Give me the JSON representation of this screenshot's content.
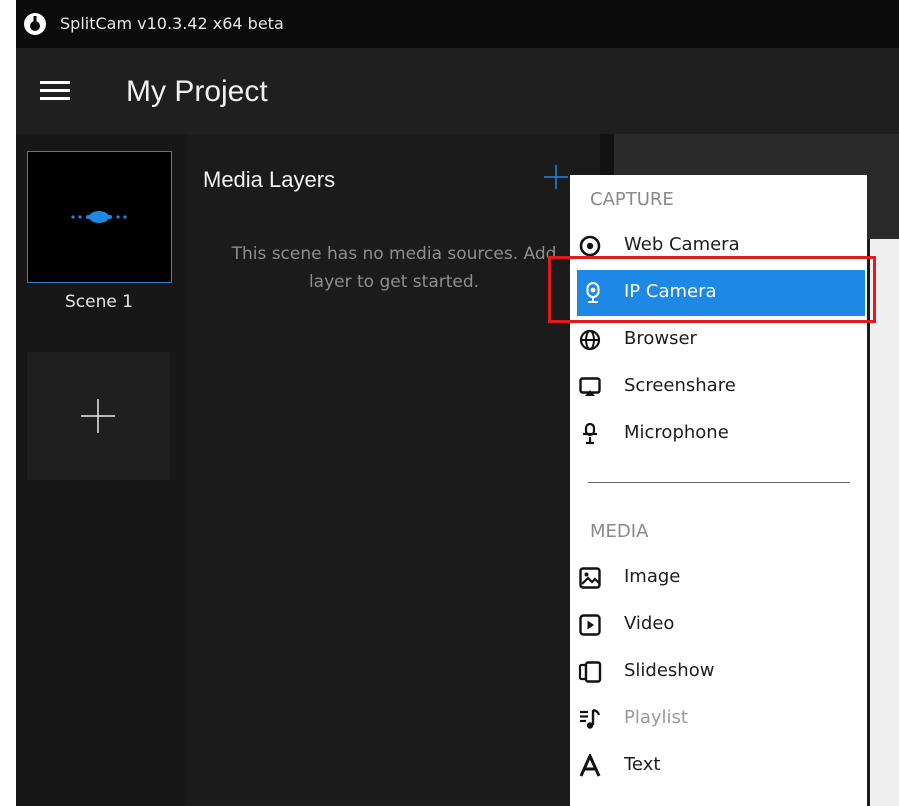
{
  "app": {
    "title": "SplitCam v10.3.42 x64 beta"
  },
  "header": {
    "project_title": "My Project"
  },
  "scenes": {
    "items": [
      {
        "label": "Scene 1"
      }
    ]
  },
  "layers": {
    "title": "Media Layers",
    "empty_message": "This scene has no media sources. Add layer to get started."
  },
  "menu": {
    "capture_header": "CAPTURE",
    "media_header": "MEDIA",
    "capture_items": [
      {
        "label": "Web Camera",
        "icon": "webcam-icon"
      },
      {
        "label": "IP Camera",
        "icon": "ip-camera-icon",
        "selected": true
      },
      {
        "label": "Browser",
        "icon": "globe-icon"
      },
      {
        "label": "Screenshare",
        "icon": "screenshare-icon"
      },
      {
        "label": "Microphone",
        "icon": "microphone-icon"
      }
    ],
    "media_items": [
      {
        "label": "Image",
        "icon": "image-icon"
      },
      {
        "label": "Video",
        "icon": "video-icon"
      },
      {
        "label": "Slideshow",
        "icon": "slideshow-icon"
      },
      {
        "label": "Playlist",
        "icon": "playlist-icon",
        "disabled": true
      },
      {
        "label": "Text",
        "icon": "text-icon"
      }
    ]
  },
  "colors": {
    "accent": "#1e88e5",
    "highlight_border": "#e01b1b",
    "titlebar_bg": "#0b0b0b",
    "panel_bg": "#1b1b1b"
  }
}
